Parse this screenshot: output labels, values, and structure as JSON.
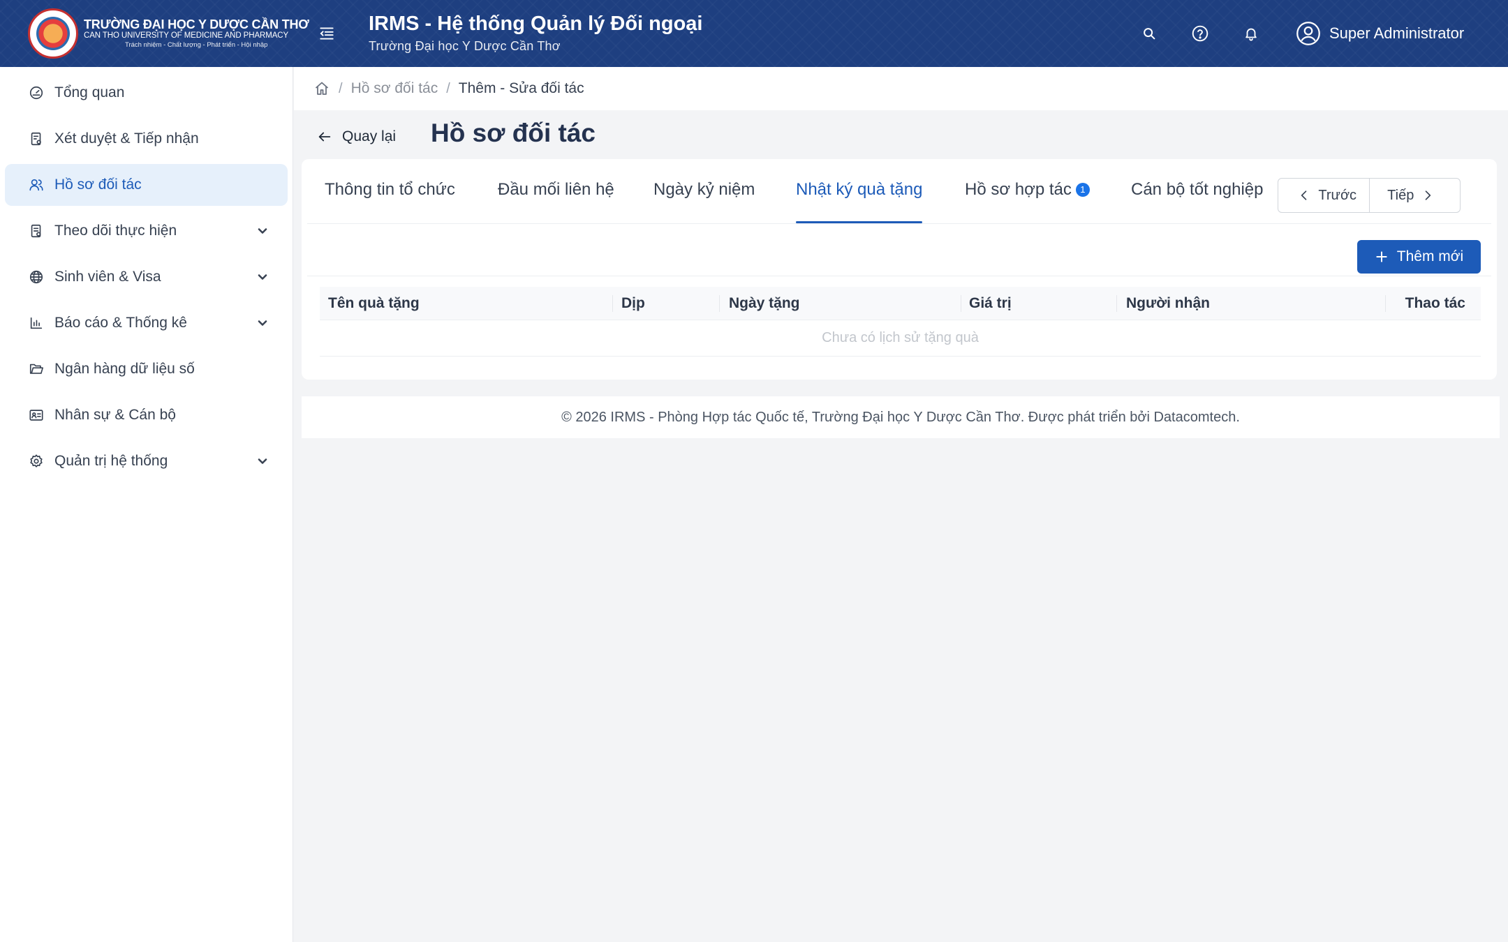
{
  "header": {
    "logo": {
      "line1": "TRƯỜNG ĐẠI HỌC Y DƯỢC CẦN THƠ",
      "line2": "CAN THO UNIVERSITY OF MEDICINE AND PHARMACY",
      "line3": "Trách nhiệm - Chất lượng - Phát triển - Hội nhập"
    },
    "title": "IRMS - Hệ thống Quản lý Đối ngoại",
    "subtitle": "Trường Đại học Y Dược Cần Thơ",
    "icons": [
      "search-icon",
      "help-icon",
      "bell-icon",
      "user-icon"
    ],
    "user_name": "Super Administrator",
    "colors": {
      "background": "#1e3f80",
      "text": "#ffffff"
    }
  },
  "sidebar": {
    "items": [
      {
        "label": "Tổng quan",
        "icon": "dashboard-icon",
        "active": false,
        "has_children": false
      },
      {
        "label": "Xét duyệt & Tiếp nhận",
        "icon": "review-icon",
        "active": false,
        "has_children": false
      },
      {
        "label": "Hồ sơ đối tác",
        "icon": "partners-icon",
        "active": true,
        "has_children": false
      },
      {
        "label": "Theo dõi thực hiện",
        "icon": "tracking-icon",
        "active": false,
        "has_children": true
      },
      {
        "label": "Sinh viên & Visa",
        "icon": "globe-icon",
        "active": false,
        "has_children": true
      },
      {
        "label": "Báo cáo & Thống kê",
        "icon": "chart-icon",
        "active": false,
        "has_children": true
      },
      {
        "label": "Ngân hàng dữ liệu số",
        "icon": "folder-icon",
        "active": false,
        "has_children": false
      },
      {
        "label": "Nhân sự & Cán bộ",
        "icon": "id-card-icon",
        "active": false,
        "has_children": false
      },
      {
        "label": "Quản trị hệ thống",
        "icon": "gear-icon",
        "active": false,
        "has_children": true
      }
    ],
    "colors": {
      "active_bg": "#e6f0fb",
      "active_text": "#1d5bb8"
    }
  },
  "breadcrumb": {
    "items": [
      "Hồ sơ đối tác",
      "Thêm - Sửa đối tác"
    ]
  },
  "page": {
    "back_label": "Quay lại",
    "title": "Hồ sơ đối tác"
  },
  "tabs": [
    {
      "label": "Thông tin tổ chức",
      "active": false
    },
    {
      "label": "Đầu mối liên hệ",
      "active": false
    },
    {
      "label": "Ngày kỷ niệm",
      "active": false
    },
    {
      "label": "Nhật ký quà tặng",
      "active": true
    },
    {
      "label": "Hồ sơ hợp tác",
      "active": false,
      "badge": "1"
    },
    {
      "label": "Cán bộ tốt nghiệp",
      "active": false
    }
  ],
  "pager": {
    "prev_label": "Trước",
    "next_label": "Tiếp"
  },
  "toolbar": {
    "add_label": "Thêm mới",
    "accent": "#1d5bb8"
  },
  "table": {
    "columns": [
      "Tên quà tặng",
      "Dịp",
      "Ngày tặng",
      "Giá trị",
      "Người nhận",
      "Thao tác"
    ],
    "rows": [],
    "empty_text": "Chưa có lịch sử tặng quà"
  },
  "footer": {
    "text": "© 2026 IRMS - Phòng Hợp tác Quốc tế, Trường Đại học Y Dược Cần Thơ. Được phát triển bởi Datacomtech."
  }
}
